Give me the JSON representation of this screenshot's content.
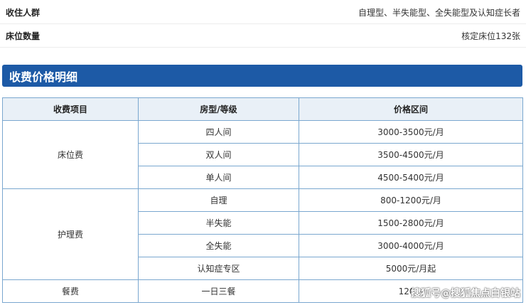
{
  "info": {
    "residents_label": "收住人群",
    "residents_value": "自理型、半失能型、全失能型及认知症长者",
    "beds_label": "床位数量",
    "beds_value": "核定床位132张"
  },
  "section": {
    "title": "收费价格明细"
  },
  "table": {
    "headers": [
      "收费项目",
      "房型/等级",
      "价格区间"
    ],
    "groups": [
      {
        "item": "床位费",
        "rows": [
          {
            "type": "四人间",
            "price": "3000-3500元/月"
          },
          {
            "type": "双人间",
            "price": "3500-4500元/月"
          },
          {
            "type": "单人间",
            "price": "4500-5400元/月"
          }
        ]
      },
      {
        "item": "护理费",
        "rows": [
          {
            "type": "自理",
            "price": "800-1200元/月"
          },
          {
            "type": "半失能",
            "price": "1500-2800元/月"
          },
          {
            "type": "全失能",
            "price": "3000-4000元/月"
          },
          {
            "type": "认知症专区",
            "price": "5000元/月起"
          }
        ]
      },
      {
        "item": "餐费",
        "rows": [
          {
            "type": "一日三餐",
            "price": "1200-"
          }
        ]
      }
    ]
  },
  "watermark": "搜狐号@搜狐焦点白银站"
}
